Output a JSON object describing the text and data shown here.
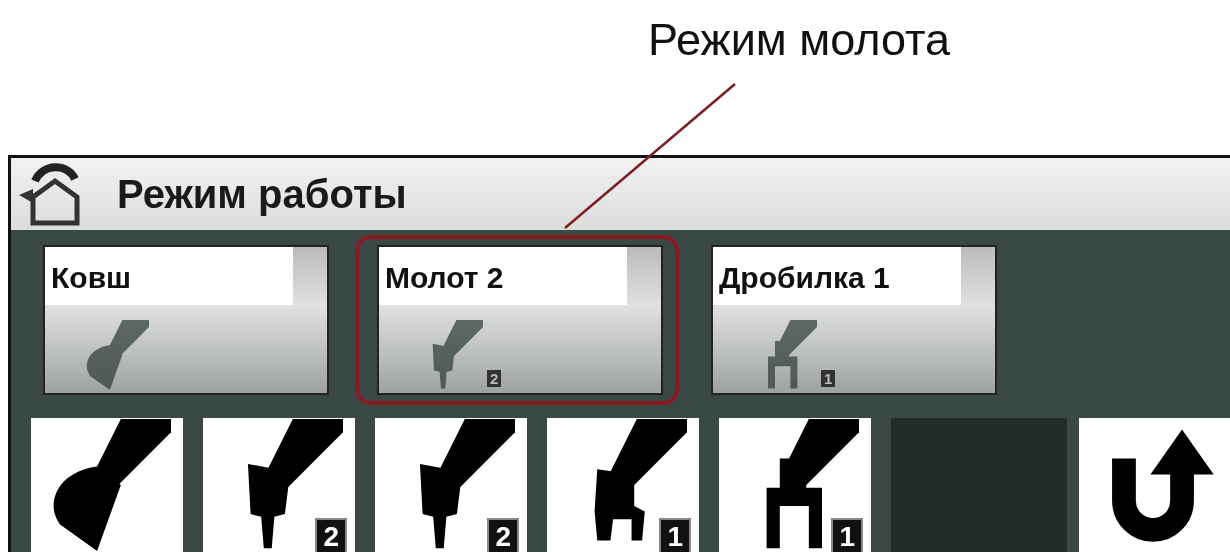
{
  "callout": {
    "text": "Режим молота"
  },
  "window": {
    "title": "Режим работы"
  },
  "modes": [
    {
      "label": "Ковш",
      "kind": "bucket",
      "highlighted": false
    },
    {
      "label": "Молот 2",
      "kind": "hammer",
      "badge": "2",
      "highlighted": true
    },
    {
      "label": "Дробилка 1",
      "kind": "crusher",
      "badge": "1",
      "highlighted": false
    }
  ],
  "tools": [
    {
      "kind": "bucket"
    },
    {
      "kind": "hammer",
      "badge": "2"
    },
    {
      "kind": "hammer",
      "badge": "2"
    },
    {
      "kind": "grapple",
      "badge": "1"
    },
    {
      "kind": "crusher",
      "badge": "1"
    }
  ]
}
